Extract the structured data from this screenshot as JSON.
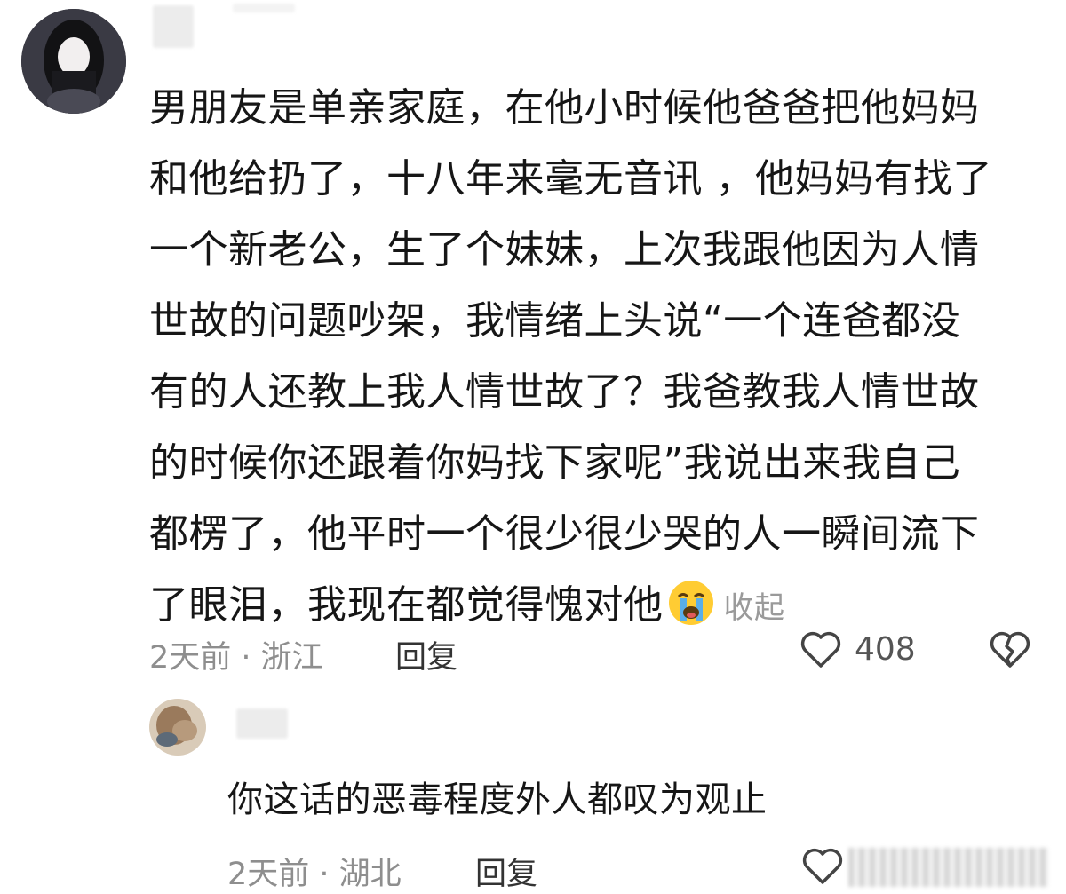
{
  "main_comment": {
    "lines": [
      "男朋友是单亲家庭，在他小时候他爸爸把他妈妈",
      "和他给扔了，十八年来毫无音讯 ，他妈妈有找了",
      "一个新老公，生了个妹妹，上次我跟他因为人情",
      "世故的问题吵架，我情绪上头说“一个连爸都没",
      "有的人还教上我人情世故了？我爸教我人情世故",
      "的时候你还跟着你妈找下家呢”我说出来我自己",
      "都楞了，他平时一个很少很少哭的人一瞬间流下",
      "了眼泪，我现在都觉得愧对他"
    ],
    "emoji": "crying-face",
    "collapse_label": "收起",
    "time_location": "2天前 · 浙江",
    "reply_label": "回复",
    "like_count": "408"
  },
  "reply_comment": {
    "text": "你这话的恶毒程度外人都叹为观止",
    "time_location": "2天前 · 湖北",
    "reply_label": "回复"
  }
}
